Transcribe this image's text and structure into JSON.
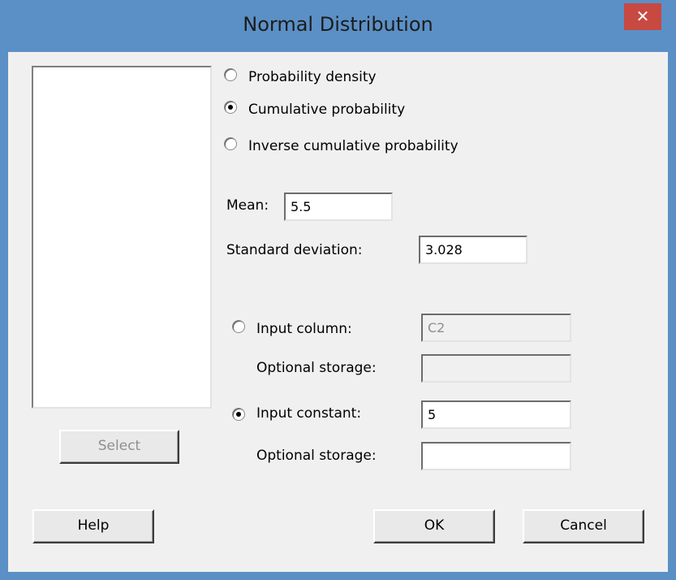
{
  "window": {
    "title": "Normal Distribution",
    "close_label": "✕"
  },
  "distribution_options": [
    {
      "label": "Probability density",
      "selected": false
    },
    {
      "label": "Cumulative probability",
      "selected": true
    },
    {
      "label": "Inverse cumulative probability",
      "selected": false
    }
  ],
  "parameters": {
    "mean_label": "Mean:",
    "mean_value": "5.5",
    "sd_label": "Standard deviation:",
    "sd_value": "3.028"
  },
  "input_column": {
    "label": "Input column:",
    "value": "C2",
    "storage_label": "Optional storage:",
    "storage_value": "",
    "selected": false
  },
  "input_constant": {
    "label": "Input constant:",
    "value": "5",
    "storage_label": "Optional storage:",
    "storage_value": "",
    "selected": true
  },
  "buttons": {
    "select": "Select",
    "help": "Help",
    "ok": "OK",
    "cancel": "Cancel"
  }
}
